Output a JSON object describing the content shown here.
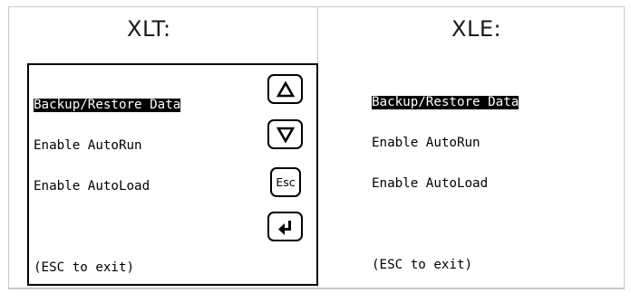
{
  "headings": {
    "xlt": "XLT:",
    "xle": "XLE:"
  },
  "xlt_screen": {
    "menu_items": [
      "Backup/Restore Data",
      "Enable AutoRun",
      "Enable AutoLoad"
    ],
    "selected_item": "Backup/Restore Data",
    "hint": "(ESC to exit)",
    "keys": {
      "up_icon": "up-triangle-icon",
      "down_icon": "down-triangle-icon",
      "esc_label": "Esc",
      "enter_icon": "enter-arrow-icon"
    }
  },
  "xle_screen": {
    "menu_items": [
      "Backup/Restore Data",
      "Enable AutoRun",
      "Enable AutoLoad"
    ],
    "selected_item": "Backup/Restore Data",
    "hint": "(ESC to exit)"
  },
  "colors": {
    "text": "#000000",
    "selection_bg": "#000000",
    "selection_fg": "#ffffff",
    "table_border": "#c8c8c8"
  }
}
